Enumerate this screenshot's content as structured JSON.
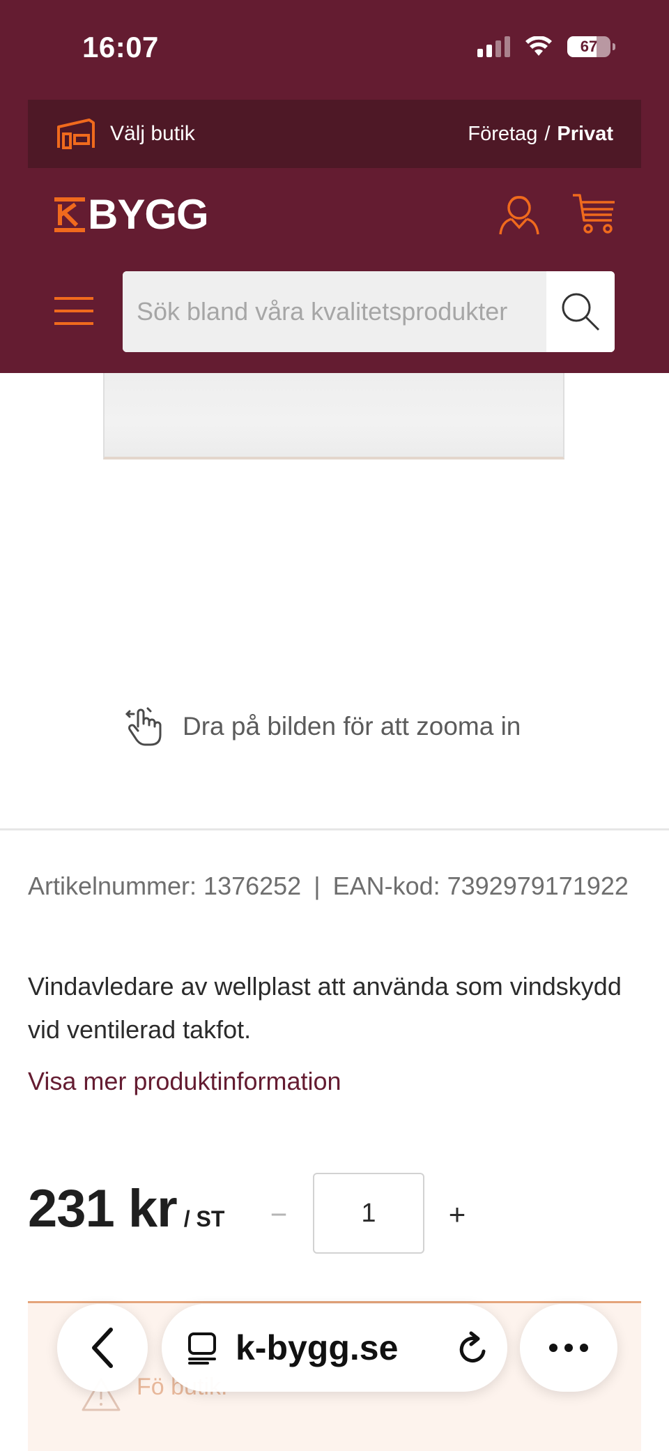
{
  "colors": {
    "brand": "#641c31",
    "brand_dark": "#4e1826",
    "accent": "#f06a1d",
    "link": "#641c31"
  },
  "status_bar": {
    "time": "16:07",
    "battery_level": "67"
  },
  "store_bar": {
    "label": "Välj butik",
    "segment_business": "Företag",
    "segment_separator": "/",
    "segment_private": "Privat"
  },
  "logo": {
    "text": "BYGG"
  },
  "search": {
    "placeholder": "Sök bland våra kvalitetsprodukter"
  },
  "product": {
    "zoom_hint": "Dra på bilden för att zooma in",
    "article_label": "Artikelnummer: 1376252",
    "ean_label": "EAN-kod: 7392979171922",
    "description": "Vindavledare av wellplast att använda som vindskydd vid ventilerad takfot.",
    "more_info_link": "Visa mer produktinformation",
    "price": "231 kr",
    "price_unit": "/ ST",
    "quantity": "1",
    "decrement": "−",
    "increment": "+"
  },
  "notice": {
    "text": "Fö                                              butik."
  },
  "browser": {
    "url": "k-bygg.se"
  }
}
